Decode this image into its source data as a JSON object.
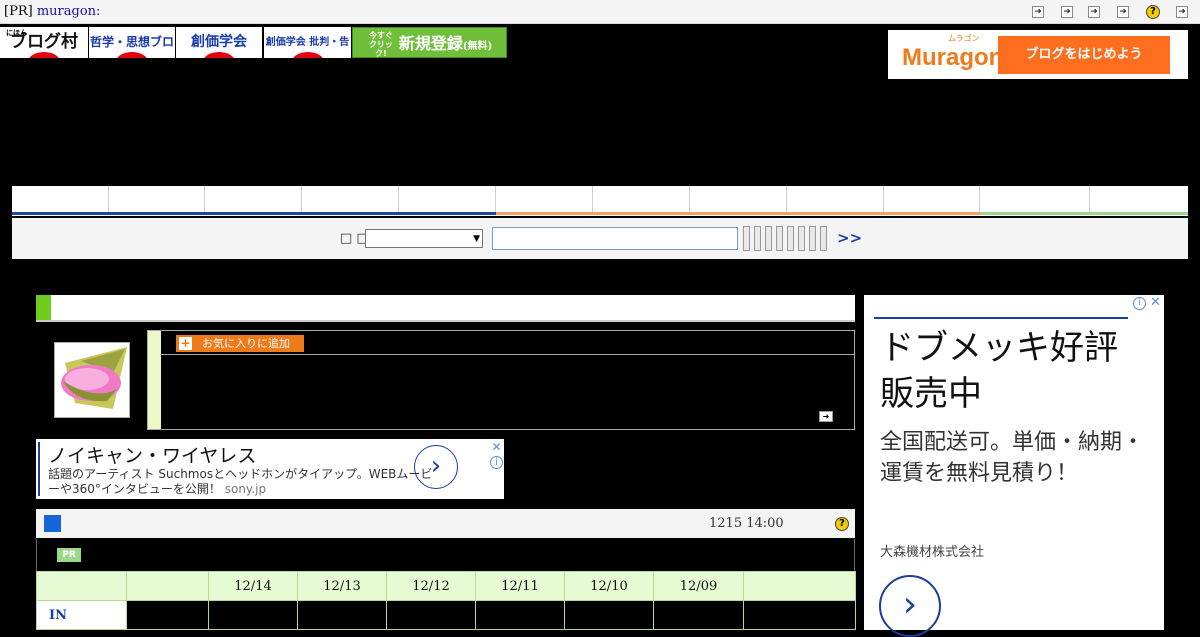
{
  "topbar": {
    "pr_bracket": "[PR]",
    "pr_link": "muragon:",
    "help_glyph": "?"
  },
  "banners": [
    {
      "label": "ブログ村",
      "small": "にほん"
    },
    {
      "label": "哲学・思想ブログ"
    },
    {
      "label": "創価学会"
    },
    {
      "label": "創価学会 批判・告発"
    },
    {
      "small": "今すぐクリック!",
      "label": "新規登録",
      "suffix": "(無料)"
    }
  ],
  "muragon": {
    "ruby": "ムラゴン",
    "logo": "Muragon",
    "button": "ブログをはじめよう"
  },
  "search": {
    "label": "□ □",
    "go": ">>"
  },
  "profile": {
    "fav_button": "お気に入りに追加"
  },
  "ad_sony": {
    "title": "ノイキャン・ワイヤレス",
    "description": "話題のアーティスト Suchmosとヘッドホンがタイアップ。WEBムービーや360°インタビューを公開！",
    "source": "sony.jp"
  },
  "ranking": {
    "timestamp": "1215 14:00",
    "help_glyph": "?",
    "pr_badge": "PR",
    "dates": [
      "12/14",
      "12/13",
      "12/12",
      "12/11",
      "12/10",
      "12/09"
    ],
    "row_label": "IN"
  },
  "ad_right": {
    "title": "ドブメッキ好評販売中",
    "description": "全国配送可。単価・納期・運賃を無料見積り！",
    "advertiser": "大森機材株式会社"
  },
  "colors": {
    "accent_orange": "#ff6d1f",
    "nav_blue": "#1c47a8",
    "nav_orange": "#f3a063",
    "nav_green": "#9bd98a"
  }
}
